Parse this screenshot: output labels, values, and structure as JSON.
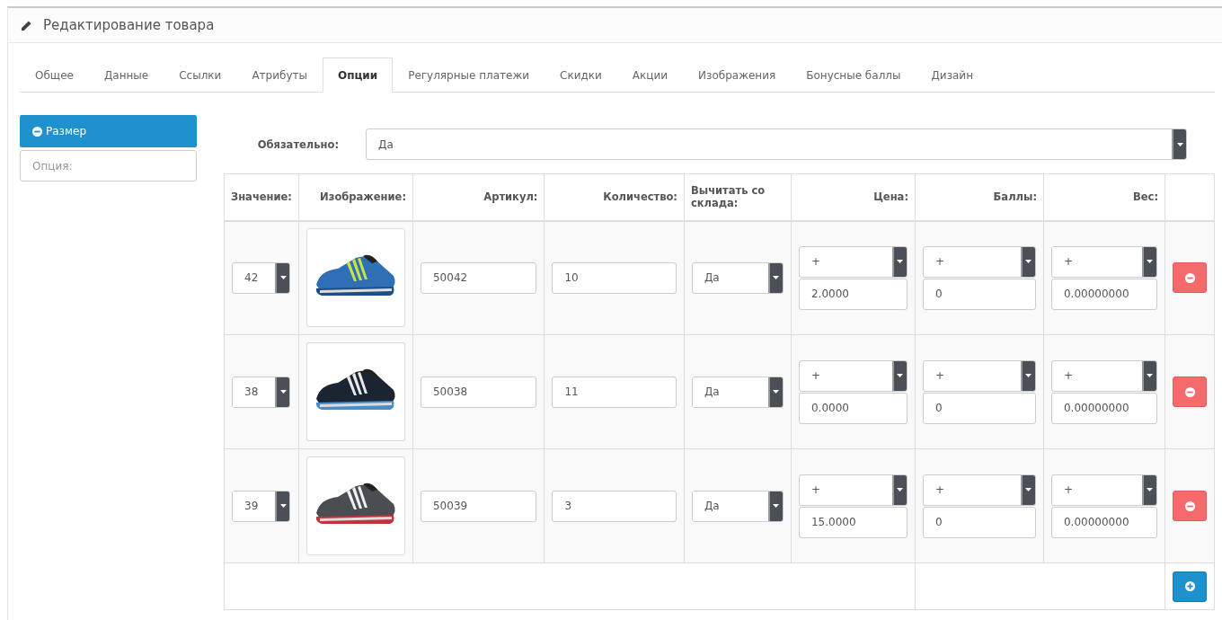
{
  "heading": {
    "title": "Редактирование товара"
  },
  "tabs": [
    {
      "label": "Общее",
      "selected": false
    },
    {
      "label": "Данные",
      "selected": false
    },
    {
      "label": "Ссылки",
      "selected": false
    },
    {
      "label": "Атрибуты",
      "selected": false
    },
    {
      "label": "Опции",
      "selected": true
    },
    {
      "label": "Регулярные платежи",
      "selected": false
    },
    {
      "label": "Скидки",
      "selected": false
    },
    {
      "label": "Акции",
      "selected": false
    },
    {
      "label": "Изображения",
      "selected": false
    },
    {
      "label": "Бонусные баллы",
      "selected": false
    },
    {
      "label": "Дизайн",
      "selected": false
    }
  ],
  "options_sidebar": {
    "items": [
      {
        "label": "Размер",
        "selected": true
      }
    ],
    "add_field": {
      "placeholder": "Опция:"
    }
  },
  "required": {
    "label": "Обязательно:",
    "value": "Да"
  },
  "table": {
    "columns": [
      "Значение:",
      "Изображение:",
      "Артикул:",
      "Количество:",
      "Вычитать со склада:",
      "Цена:",
      "Баллы:",
      "Вес:"
    ],
    "rows": [
      {
        "value": "42",
        "sku": "50042",
        "quantity": "10",
        "subtract": "Да",
        "price_prefix": "+",
        "price": "2.0000",
        "points_prefix": "+",
        "points": "0",
        "weight_prefix": "+",
        "weight": "0.00000000"
      },
      {
        "value": "38",
        "sku": "50038",
        "quantity": "11",
        "subtract": "Да",
        "price_prefix": "+",
        "price": "0.0000",
        "points_prefix": "+",
        "points": "0",
        "weight_prefix": "+",
        "weight": "0.00000000"
      },
      {
        "value": "39",
        "sku": "50039",
        "quantity": "3",
        "subtract": "Да",
        "price_prefix": "+",
        "price": "15.0000",
        "points_prefix": "+",
        "points": "0",
        "weight_prefix": "+",
        "weight": "0.00000000"
      }
    ]
  }
}
